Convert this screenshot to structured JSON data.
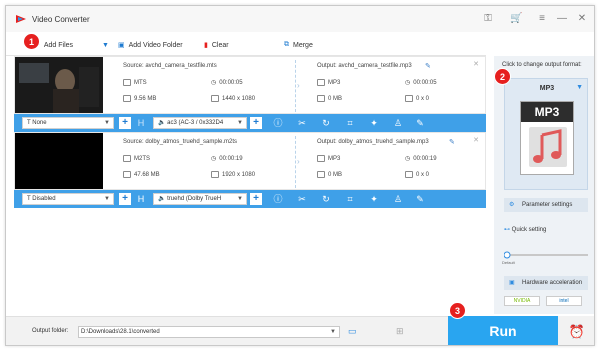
{
  "app": {
    "title": "Video Converter",
    "brand_color": "#2f9be8",
    "badge_color": "#e6201f"
  },
  "toolbar": {
    "add_files": "Add Files",
    "add_video_folder": "Add Video Folder",
    "clear": "Clear",
    "merge": "Merge"
  },
  "badges": [
    "1",
    "2",
    "3"
  ],
  "files": [
    {
      "source": "Source: avchd_camera_testfile.mts",
      "output": "Output: avchd_camera_testfile.mp3",
      "src_format": "MTS",
      "src_duration": "00:00:05",
      "src_size": "9.56 MB",
      "src_resolution": "1440 x 1080",
      "out_format": "MP3",
      "out_duration": "00:00:05",
      "out_size": "0 MB",
      "out_resolution": "0 x 0",
      "subtitle": "None",
      "audio": "ac3 (AC-3 / 0x332D4"
    },
    {
      "source": "Source: dolby_atmos_truehd_sample.m2ts",
      "output": "Output: dolby_atmos_truehd_sample.mp3",
      "src_format": "M2TS",
      "src_duration": "00:00:19",
      "src_size": "47.68 MB",
      "src_resolution": "1920 x 1080",
      "out_format": "MP3",
      "out_duration": "00:00:19",
      "out_size": "0 MB",
      "out_resolution": "0 x 0",
      "subtitle": "Disabled",
      "audio": "truehd (Dolby TrueH"
    }
  ],
  "right_panel": {
    "hint": "Click to change output format:",
    "format": "MP3",
    "format_icon_text": "MP3",
    "parameter_settings": "Parameter settings",
    "quick_setting": "Quick setting",
    "default_label": "Default",
    "hardware_acceleration": "Hardware acceleration",
    "nvidia": "NVIDIA",
    "intel": "intel"
  },
  "bottom": {
    "output_folder_label": "Output folder:",
    "output_folder_value": "D:\\Downloads\\28.1\\converted",
    "run": "Run"
  }
}
